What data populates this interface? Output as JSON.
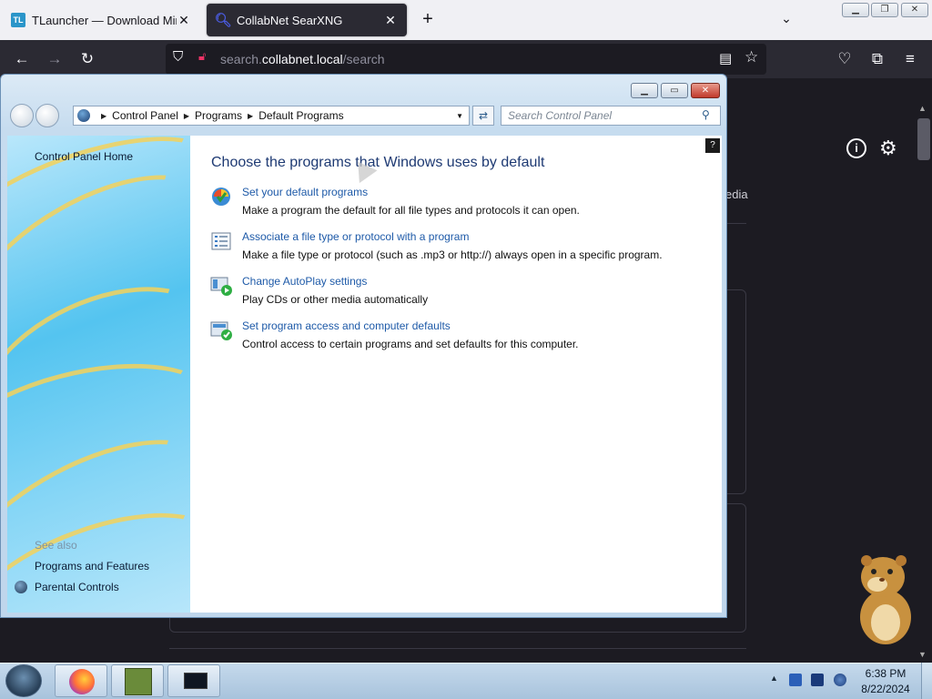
{
  "browser": {
    "tabs": [
      {
        "title": "TLauncher — Download Mined",
        "favicon": "TL"
      },
      {
        "title": "CollabNet SearXNG",
        "favicon": "search-favicon"
      }
    ],
    "url_prefix": "search.",
    "url_host": "collabnet.local",
    "url_path": "/search"
  },
  "page_behind": {
    "tab_media": "edia"
  },
  "control_panel": {
    "breadcrumb": [
      "Control Panel",
      "Programs",
      "Default Programs"
    ],
    "search_placeholder": "Search Control Panel",
    "sidebar": {
      "home": "Control Panel Home",
      "see_also": "See also",
      "links": [
        "Programs and Features",
        "Parental Controls"
      ]
    },
    "heading": "Choose the programs that Windows uses by default",
    "items": [
      {
        "link": "Set your default programs",
        "desc": "Make a program the default for all file types and protocols it can open.",
        "icon": "default-programs-icon"
      },
      {
        "link": "Associate a file type or protocol with a program",
        "desc": "Make a file type or protocol (such as .mp3 or http://) always open in a specific program.",
        "icon": "file-association-icon"
      },
      {
        "link": "Change AutoPlay settings",
        "desc": "Play CDs or other media automatically",
        "icon": "autoplay-icon"
      },
      {
        "link": "Set program access and computer defaults",
        "desc": "Control access to certain programs and set defaults for this computer.",
        "icon": "program-access-icon"
      }
    ]
  },
  "taskbar": {
    "time": "6:38 PM",
    "date": "8/22/2024"
  }
}
